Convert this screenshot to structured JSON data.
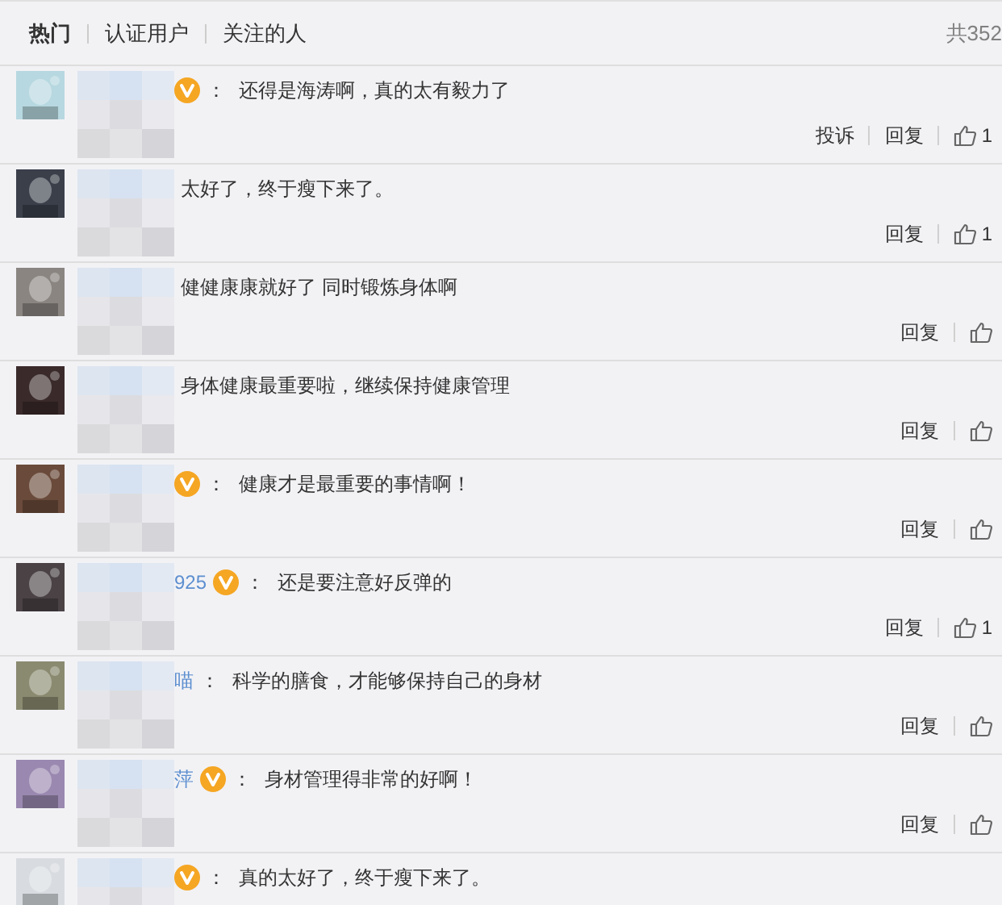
{
  "tabs": [
    {
      "label": "热门",
      "selected": true
    },
    {
      "label": "认证用户",
      "selected": false
    },
    {
      "label": "关注的人",
      "selected": false
    }
  ],
  "total": "共352",
  "comments": [
    {
      "verified": true,
      "sep": "：",
      "text": "还得是海涛啊，真的太有毅力了",
      "actions": [
        "投诉",
        "回复"
      ],
      "likes": "1"
    },
    {
      "verified": false,
      "text": "太好了，终于瘦下来了。",
      "actions": [
        "回复"
      ],
      "likes": "1"
    },
    {
      "verified": false,
      "text": "健健康康就好了 同时锻炼身体啊",
      "actions": [
        "回复"
      ]
    },
    {
      "verified": false,
      "text": "身体健康最重要啦，继续保持健康管理",
      "actions": [
        "回复"
      ]
    },
    {
      "verified": true,
      "sep": "：",
      "text": "健康才是最重要的事情啊！",
      "actions": [
        "回复"
      ]
    },
    {
      "name_fragment": "925",
      "verified": true,
      "sep": "：",
      "text": "还是要注意好反弹的",
      "actions": [
        "回复"
      ],
      "likes": "1"
    },
    {
      "name_fragment": "喵",
      "verified": false,
      "sep": "：",
      "text": "科学的膳食，才能够保持自己的身材",
      "actions": [
        "回复"
      ]
    },
    {
      "name_fragment": "萍",
      "verified": true,
      "sep": "：",
      "text": "身材管理得非常的好啊！",
      "actions": [
        "回复"
      ]
    },
    {
      "verified": true,
      "sep": "：",
      "text": "真的太好了，终于瘦下来了。"
    }
  ]
}
